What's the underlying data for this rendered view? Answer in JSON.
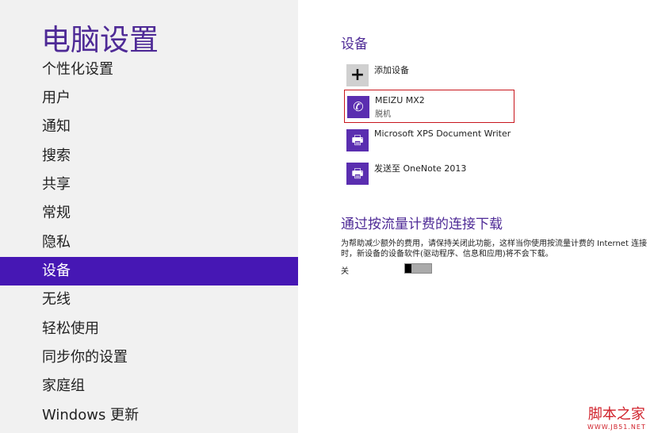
{
  "title": "电脑设置",
  "nav": [
    "个性化设置",
    "用户",
    "通知",
    "搜索",
    "共享",
    "常规",
    "隐私",
    "设备",
    "无线",
    "轻松使用",
    "同步你的设置",
    "家庭组",
    "Windows 更新"
  ],
  "selected_nav": "设备",
  "devices_heading": "设备",
  "devices": [
    {
      "name": "添加设备",
      "icon": "plus-icon"
    },
    {
      "name": "MEIZU MX2",
      "status": "脱机",
      "icon": "phone-icon"
    },
    {
      "name": "Microsoft XPS Document Writer",
      "icon": "printer-icon"
    },
    {
      "name": "发送至 OneNote 2013",
      "icon": "printer-icon"
    }
  ],
  "metered_heading": "通过按流量计费的连接下载",
  "metered_desc": "为帮助减少额外的费用，请保持关闭此功能，这样当你使用按流量计费的 Internet 连接时，新设备的设备软件(驱动程序、信息和应用)将不会下载。",
  "toggle_label": "关",
  "toggle_on": false,
  "watermark": {
    "cn": "脚本之家",
    "url": "WWW.JB51.NET"
  },
  "colors": {
    "accent": "#4617b4",
    "title": "#4e2a96",
    "highlight": "#c8161d"
  }
}
